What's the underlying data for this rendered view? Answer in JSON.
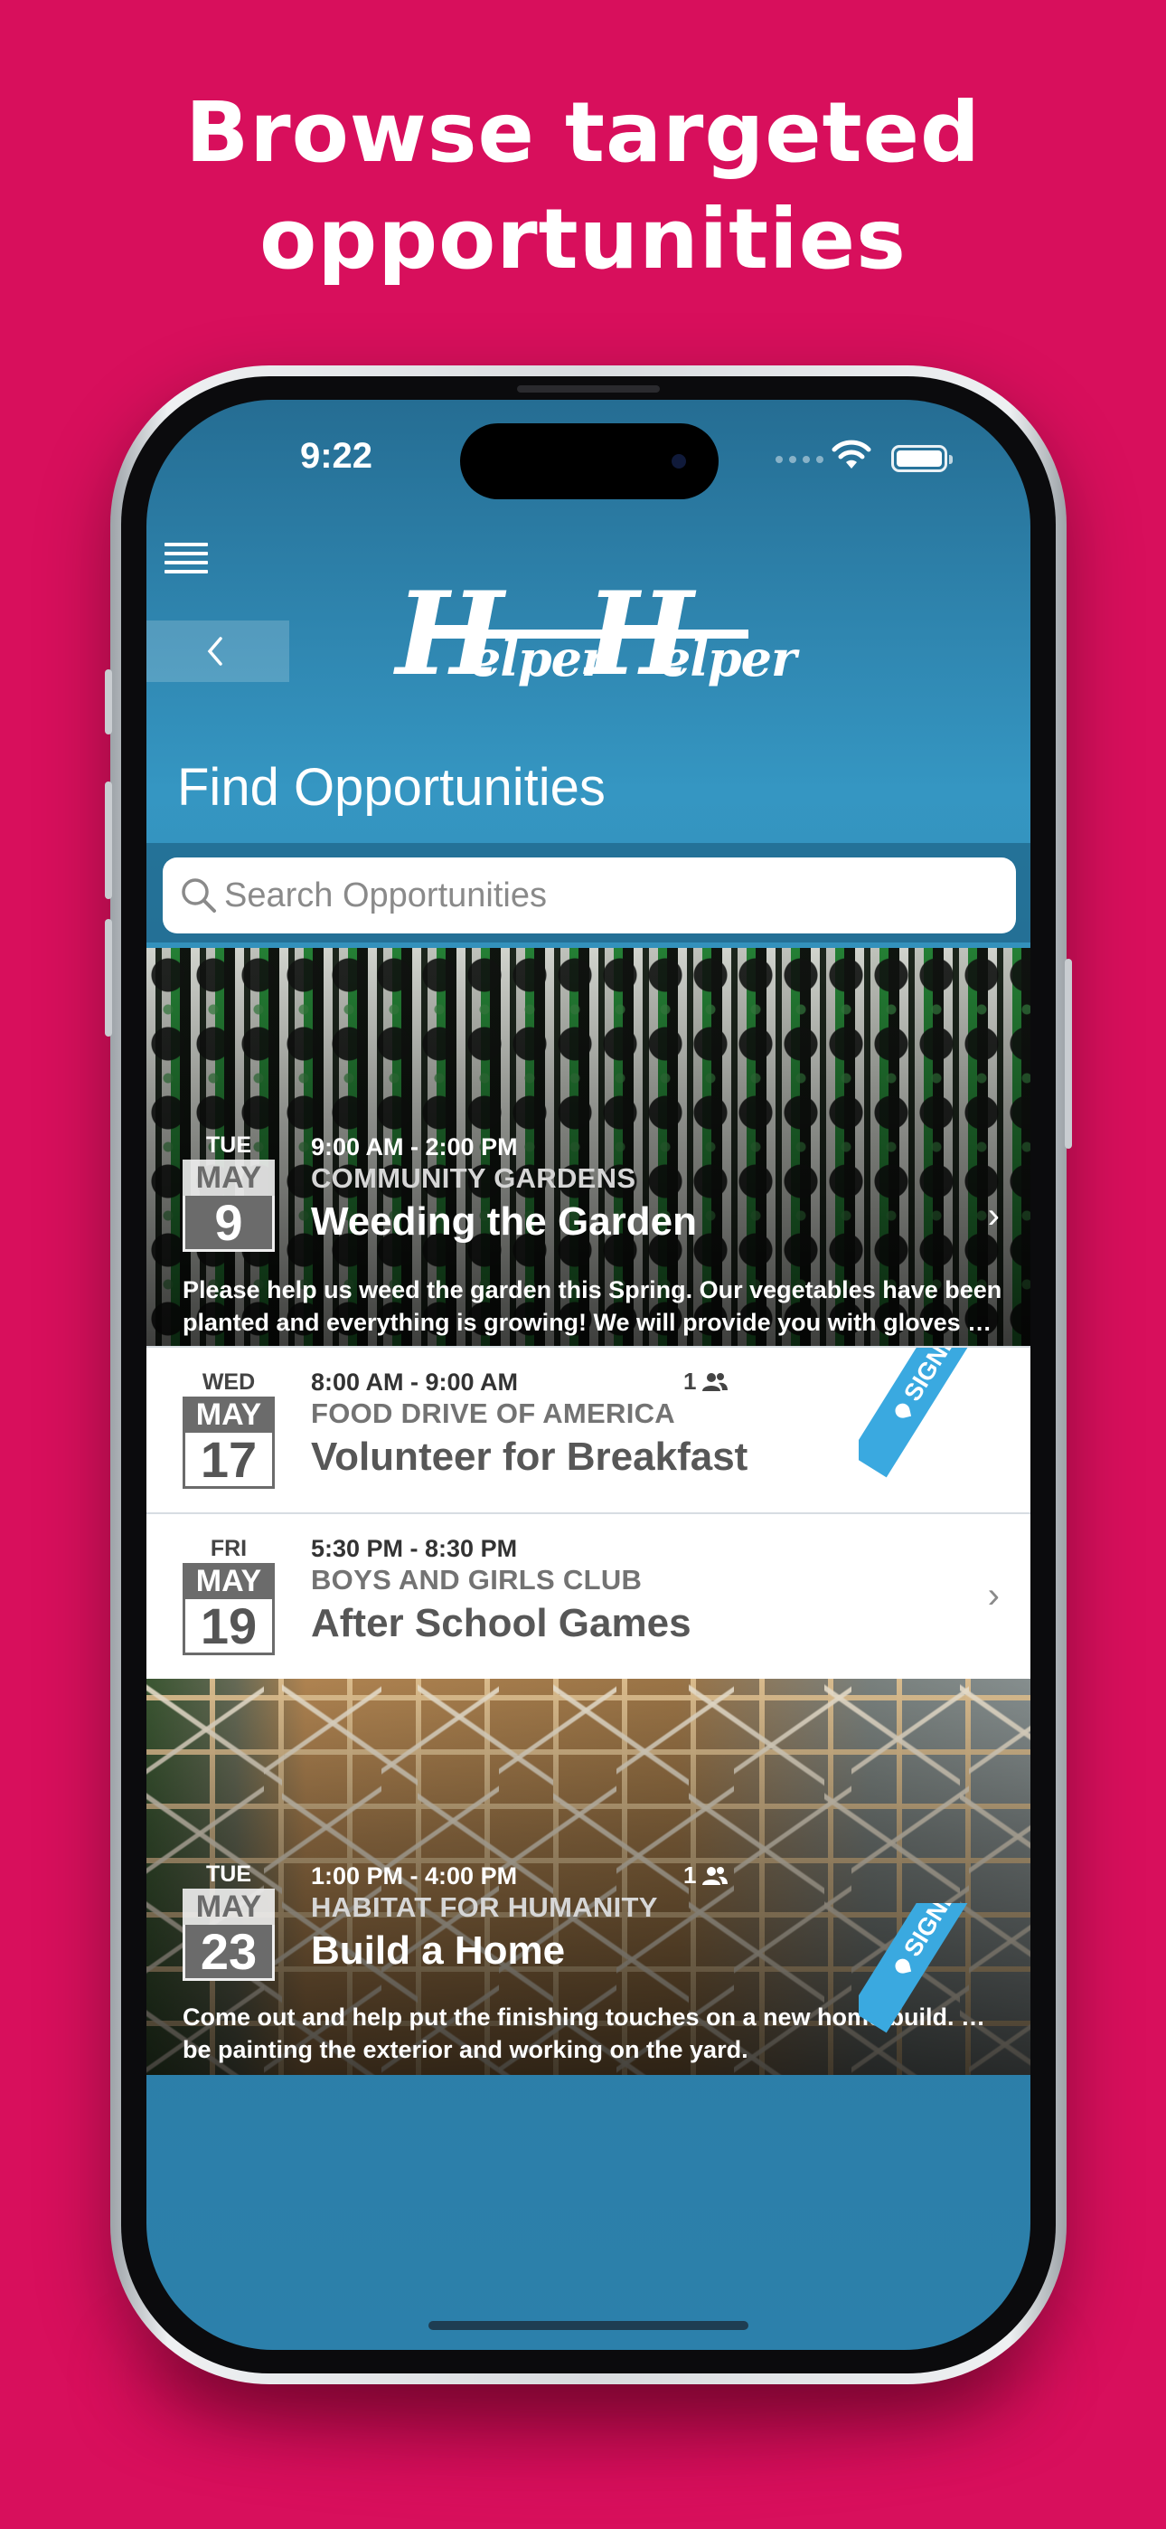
{
  "headline": {
    "line1": "Browse targeted",
    "line2": "opportunities"
  },
  "status_bar": {
    "time": "9:22"
  },
  "header": {
    "logo_text_1": "H",
    "logo_text_2": "elper",
    "logo_text_3": "H",
    "logo_text_4": "elper",
    "page_title": "Find Opportunities"
  },
  "search": {
    "placeholder": "Search Opportunities"
  },
  "colors": {
    "background": "#d80f5c",
    "screen_blue": "#2f86b0",
    "signed_up_ribbon": "#3aa9e0"
  },
  "opportunities": [
    {
      "dow": "TUE",
      "month": "MAY",
      "day": "9",
      "time": "9:00 AM - 2:00 PM",
      "org": "COMMUNITY GARDENS",
      "title": "Weeding the Garden",
      "description_1": "Please help us weed the garden this Spring. Our vegetables have been",
      "description_2": "planted and everything is growing! We will provide you with gloves and t…",
      "has_image": true,
      "chevron": "›"
    },
    {
      "dow": "WED",
      "month": "MAY",
      "day": "17",
      "time": "8:00 AM - 9:00 AM",
      "org": "FOOD DRIVE OF AMERICA",
      "title": "Volunteer for Breakfast",
      "count": "1",
      "ribbon": "SIGNED UP"
    },
    {
      "dow": "FRI",
      "month": "MAY",
      "day": "19",
      "time": "5:30 PM - 8:30 PM",
      "org": "BOYS AND GIRLS CLUB",
      "title": "After School Games",
      "chevron": "›"
    },
    {
      "dow": "TUE",
      "month": "MAY",
      "day": "23",
      "time": "1:00 PM - 4:00 PM",
      "org": "HABITAT FOR HUMANITY",
      "title": "Build a Home",
      "description_1": "Come out and help put the finishing touches on a new home build. We will",
      "description_2": "be painting the exterior and working on the yard.",
      "count": "1",
      "ribbon": "SIGNED UP",
      "has_image": true
    }
  ],
  "icons": [
    "menu-icon",
    "back-chevron-icon",
    "search-icon",
    "people-icon",
    "chevron-right-icon",
    "wifi-icon",
    "battery-icon",
    "pin-icon"
  ]
}
